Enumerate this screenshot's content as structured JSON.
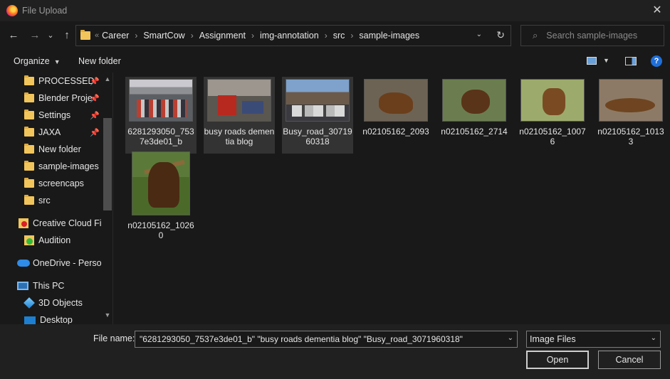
{
  "window": {
    "title": "File Upload",
    "close_glyph": "✕"
  },
  "nav": {
    "back_glyph": "←",
    "forward_glyph": "→",
    "recent_glyph": "⌄",
    "up_glyph": "↑",
    "breadcrumb_start": "«",
    "breadcrumbs": [
      "Career",
      "SmartCow",
      "Assignment",
      "img-annotation",
      "src",
      "sample-images"
    ],
    "separator": "›",
    "dropdown_glyph": "⌄",
    "refresh_glyph": "↻",
    "search_placeholder": "Search sample-images",
    "search_glyph": "⌕"
  },
  "toolbar": {
    "organize_label": "Organize",
    "caret": "▼",
    "new_folder_label": "New folder",
    "help_label": "?"
  },
  "sidebar": {
    "items": [
      {
        "label": "PROCESSED",
        "icon": "folder-icon",
        "pinned": true
      },
      {
        "label": "Blender Proje",
        "icon": "folder-icon",
        "pinned": true
      },
      {
        "label": "Settings",
        "icon": "folder-icon",
        "pinned": true
      },
      {
        "label": "JAXA",
        "icon": "folder-icon",
        "pinned": true
      },
      {
        "label": "New folder",
        "icon": "folder-icon",
        "pinned": false
      },
      {
        "label": "sample-images",
        "icon": "folder-icon",
        "pinned": false
      },
      {
        "label": "screencaps",
        "icon": "folder-icon",
        "pinned": false
      },
      {
        "label": "src",
        "icon": "folder-icon",
        "pinned": false
      },
      {
        "label": "Creative Cloud Fil",
        "icon": "creative-cloud-icon",
        "pinned": false
      },
      {
        "label": "Audition",
        "icon": "audition-folder-icon",
        "pinned": false
      },
      {
        "label": "OneDrive - Persor",
        "icon": "onedrive-icon",
        "pinned": false
      },
      {
        "label": "This PC",
        "icon": "this-pc-icon",
        "pinned": false
      },
      {
        "label": "3D Objects",
        "icon": "3d-objects-icon",
        "pinned": false
      },
      {
        "label": "Desktop",
        "icon": "desktop-icon",
        "pinned": false
      }
    ],
    "pin_glyph": "📌",
    "scroll_up": "▲",
    "scroll_down": "▼"
  },
  "files": [
    {
      "name": "6281293050_7537e3de01_b",
      "selected": true
    },
    {
      "name": "busy roads dementia blog",
      "selected": true
    },
    {
      "name": "Busy_road_3071960318",
      "selected": true
    },
    {
      "name": "n02105162_2093",
      "selected": false
    },
    {
      "name": "n02105162_2714",
      "selected": false
    },
    {
      "name": "n02105162_10076",
      "selected": false
    },
    {
      "name": "n02105162_10133",
      "selected": false
    },
    {
      "name": "n02105162_10260",
      "selected": false
    }
  ],
  "bottom": {
    "file_name_label": "File name:",
    "file_name_value": "\"6281293050_7537e3de01_b\" \"busy roads dementia blog\" \"Busy_road_3071960318\"",
    "file_type_value": "Image Files",
    "dropdown_glyph": "⌄",
    "open_label": "Open",
    "cancel_label": "Cancel"
  }
}
